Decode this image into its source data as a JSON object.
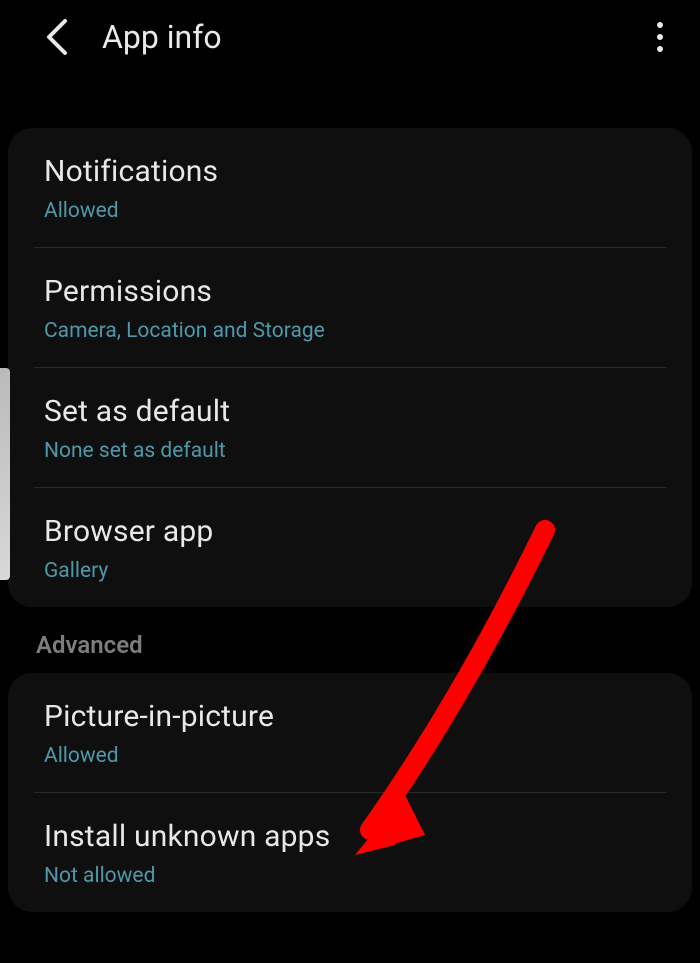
{
  "header": {
    "title": "App info"
  },
  "sections": {
    "main": {
      "notifications": {
        "title": "Notifications",
        "subtitle": "Allowed"
      },
      "permissions": {
        "title": "Permissions",
        "subtitle": "Camera, Location and Storage"
      },
      "default": {
        "title": "Set as default",
        "subtitle": "None set as default"
      },
      "browser": {
        "title": "Browser app",
        "subtitle": "Gallery"
      }
    },
    "advanced_label": "Advanced",
    "advanced": {
      "pip": {
        "title": "Picture-in-picture",
        "subtitle": "Allowed"
      },
      "unknown": {
        "title": "Install unknown apps",
        "subtitle": "Not allowed"
      }
    }
  },
  "annotation": {
    "arrow_color": "#ff0000",
    "points_to": "install-unknown-apps"
  }
}
